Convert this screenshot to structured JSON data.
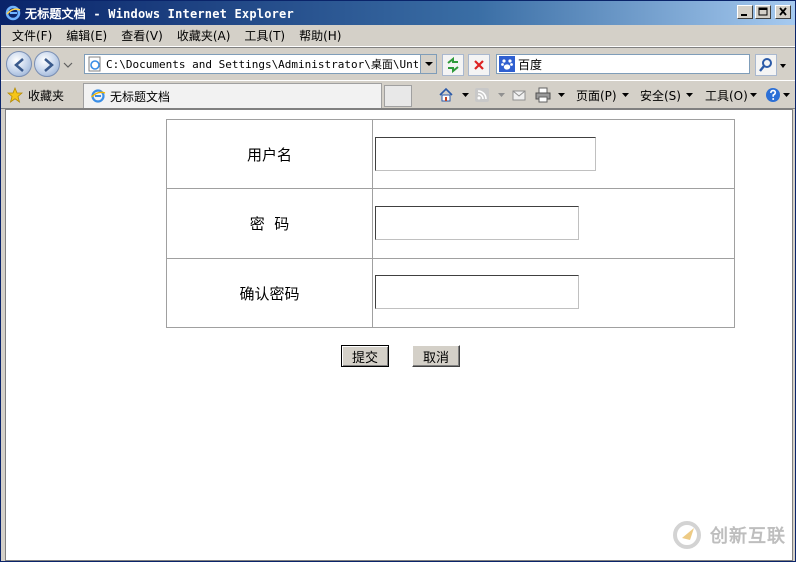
{
  "window": {
    "title": "无标题文档 - Windows Internet Explorer"
  },
  "menu": {
    "items": [
      "文件(F)",
      "编辑(E)",
      "查看(V)",
      "收藏夹(A)",
      "工具(T)",
      "帮助(H)"
    ]
  },
  "address": {
    "url": "C:\\Documents and Settings\\Administrator\\桌面\\Untitle"
  },
  "search": {
    "text": "百度"
  },
  "favorites": {
    "label": "收藏夹"
  },
  "tab": {
    "label": "无标题文档"
  },
  "commandbar": {
    "page_label": "页面(P)",
    "safety_label": "安全(S)",
    "tools_label": "工具(O)"
  },
  "form": {
    "rows": [
      {
        "label": "用户名",
        "value": ""
      },
      {
        "label": "密  码",
        "value": ""
      },
      {
        "label": "确认密码",
        "value": ""
      }
    ],
    "submit_label": "提交",
    "cancel_label": "取消"
  },
  "watermark": {
    "text": "创新互联"
  },
  "colors": {
    "title_bar": "#0a246a",
    "chrome": "#d4d0c8",
    "content_bg": "#ffffff"
  }
}
